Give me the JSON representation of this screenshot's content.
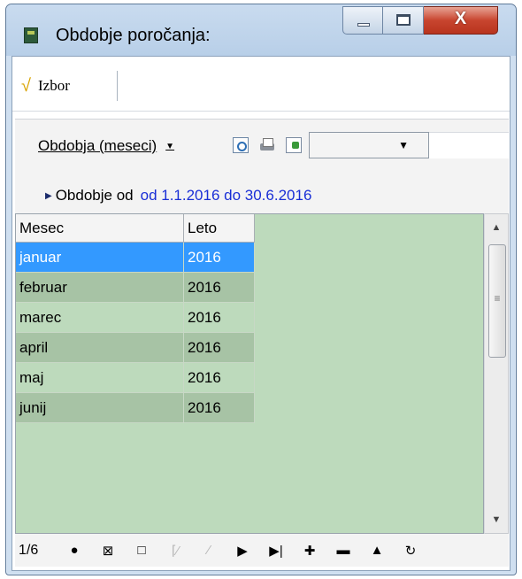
{
  "window": {
    "title": "Obdobje poročanja:",
    "buttons": {
      "close_label": "X"
    }
  },
  "toolbar": {
    "izbor_label": "Izbor"
  },
  "panel": {
    "period_menu_label": "Obdobja (meseci)",
    "combo_value": "",
    "range_label": "Obdobje od",
    "range_value": "od 1.1.2016 do 30.6.2016"
  },
  "grid": {
    "columns": [
      "Mesec",
      "Leto"
    ],
    "rows": [
      {
        "mesec": "januar",
        "leto": "2016",
        "selected": true
      },
      {
        "mesec": "februar",
        "leto": "2016"
      },
      {
        "mesec": "marec",
        "leto": "2016"
      },
      {
        "mesec": "april",
        "leto": "2016"
      },
      {
        "mesec": "maj",
        "leto": "2016"
      },
      {
        "mesec": "junij",
        "leto": "2016"
      }
    ]
  },
  "navigator": {
    "record_count": "1/6",
    "buttons": [
      "●",
      "⊠",
      "□",
      "⌈⁄",
      "⁄",
      "▶",
      "▶|",
      "✚",
      "▬",
      "▲",
      "↻"
    ]
  },
  "colors": {
    "selection": "#3399ff",
    "grid_bg": "#bddabc",
    "grid_alt": "#a7c3a5",
    "link_blue": "#1a2fd6"
  }
}
